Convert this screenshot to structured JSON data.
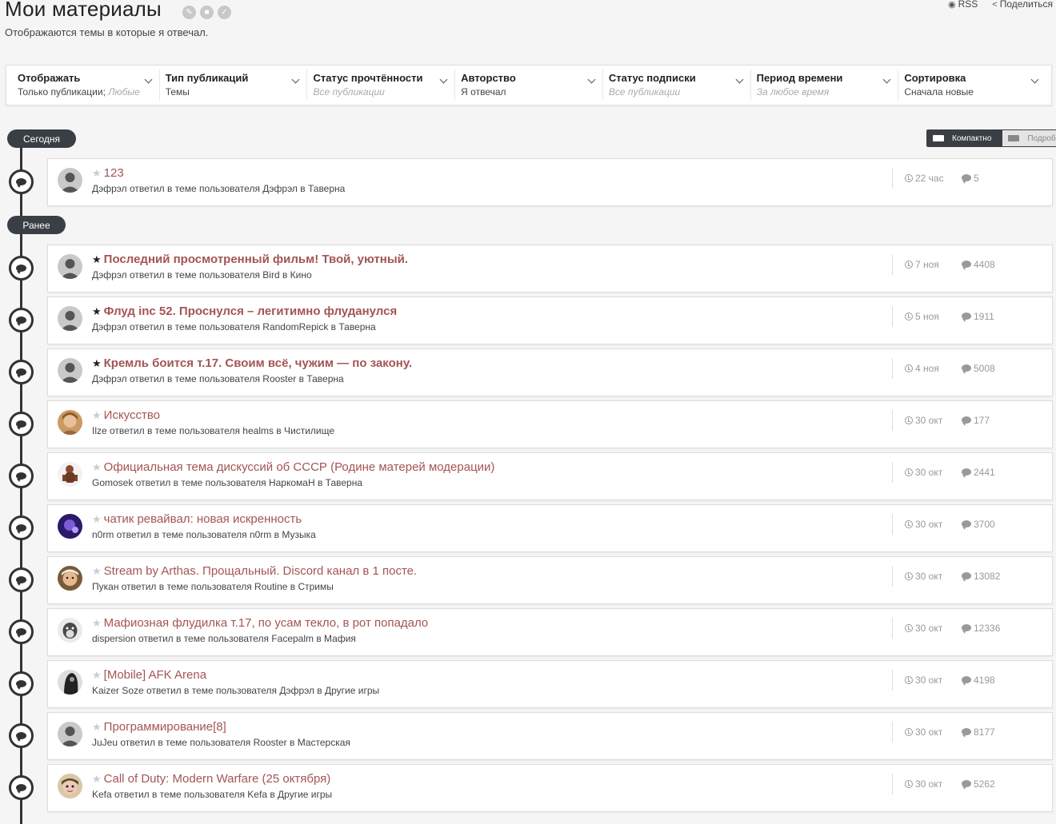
{
  "header": {
    "title": "Мои материалы",
    "subtitle": "Отображаются темы в которые я отвечал.",
    "rss_label": "RSS",
    "share_label": "Поделиться"
  },
  "filters": [
    {
      "label": "Отображать",
      "value": "Только публикации; ",
      "value_muted": "Любые"
    },
    {
      "label": "Тип публикаций",
      "value": "Темы"
    },
    {
      "label": "Статус прочтённости",
      "value": "Все публикации",
      "placeholder": true
    },
    {
      "label": "Авторство",
      "value": "Я отвечал"
    },
    {
      "label": "Статус подписки",
      "value": "Все публикации",
      "placeholder": true
    },
    {
      "label": "Период времени",
      "value": "За любое время",
      "placeholder": true
    },
    {
      "label": "Сортировка",
      "value": "Сначала новые"
    }
  ],
  "sections": {
    "today": "Сегодня",
    "earlier": "Ранее"
  },
  "view_toggle": {
    "compact": "Компактно",
    "detailed": "Подробно"
  },
  "items": [
    {
      "title": "123",
      "pinned": false,
      "sub": "Дэфрэл ответил в теме пользователя Дэфрэл в Таверна",
      "date": "22 час",
      "count": "5",
      "avatar": "default"
    },
    {
      "title": "Последний просмотренный фильм! Твой, уютный.",
      "pinned": true,
      "sub": "Дэфрэл ответил в теме пользователя Bird в Кино",
      "date": "7 ноя",
      "count": "4408",
      "avatar": "default"
    },
    {
      "title": "Флуд inc 52. Проснулся – легитимно флуданулся",
      "pinned": true,
      "sub": "Дэфрэл ответил в теме пользователя RandomRepick в Таверна",
      "date": "5 ноя",
      "count": "1911",
      "avatar": "default"
    },
    {
      "title": "Кремль боится т.17. Своим всё, чужим — по закону.",
      "pinned": true,
      "sub": "Дэфрэл ответил в теме пользователя Rooster в Таверна",
      "date": "4 ноя",
      "count": "5008",
      "avatar": "default"
    },
    {
      "title": "Искусство",
      "pinned": false,
      "sub": "Ilze ответил в теме пользователя healms в Чистилище",
      "date": "30 окт",
      "count": "177",
      "avatar": "portrait"
    },
    {
      "title": "Официальная тема дискуссий об СССР (Родине матерей модерации)",
      "pinned": false,
      "sub": "Gomosek ответил в теме пользователя НаркомаН в Таверна",
      "date": "30 окт",
      "count": "2441",
      "avatar": "figure"
    },
    {
      "title": "чатик ревайвал: новая искренность",
      "pinned": false,
      "sub": "n0rm ответил в теме пользователя n0rm в Музыка",
      "date": "30 окт",
      "count": "3700",
      "avatar": "purple"
    },
    {
      "title": "Stream by Arthas. Прощальный. Discord канал в 1 посте.",
      "pinned": false,
      "sub": "Пукан ответил в теме пользователя Routine в Стримы",
      "date": "30 окт",
      "count": "13082",
      "avatar": "face"
    },
    {
      "title": "Мафиозная флудилка т.17, по усам текло, в рот попадало",
      "pinned": false,
      "sub": "dispersion ответил в теме пользователя Facepalm в Мафия",
      "date": "30 окт",
      "count": "12336",
      "avatar": "dog"
    },
    {
      "title": "[Mobile] AFK Arena",
      "pinned": false,
      "sub": "Kaizer Soze ответил в теме пользователя Дэфрэл в Другие игры",
      "date": "30 окт",
      "count": "4198",
      "avatar": "dark"
    },
    {
      "title": "Программирование[8]",
      "pinned": false,
      "sub": "JuJeu ответил в теме пользователя Rooster в Мастерская",
      "date": "30 окт",
      "count": "8177",
      "avatar": "default"
    },
    {
      "title": "Call of Duty: Modern Warfare (25 октября)",
      "pinned": false,
      "sub": "Kefa ответил в теме пользователя Kefa в Другие игры",
      "date": "30 окт",
      "count": "5262",
      "avatar": "cartoon"
    }
  ]
}
